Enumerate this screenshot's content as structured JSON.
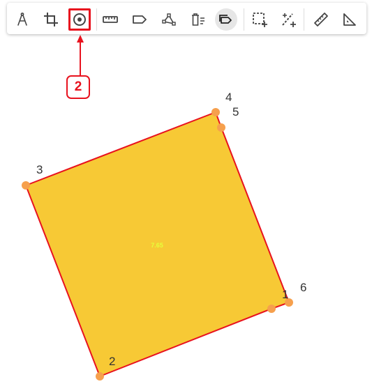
{
  "toolbar": {
    "tools": [
      {
        "id": "compass",
        "icon": "compass-icon",
        "title": ""
      },
      {
        "id": "crop",
        "icon": "crop-icon",
        "title": ""
      },
      {
        "id": "point",
        "icon": "target-point-icon",
        "title": "",
        "highlighted": true
      },
      {
        "id": "ruler",
        "icon": "ruler-icon",
        "title": ""
      },
      {
        "id": "label",
        "icon": "label-tag-icon",
        "title": ""
      },
      {
        "id": "polyline",
        "icon": "polyline-icon",
        "title": ""
      },
      {
        "id": "delete-list",
        "icon": "delete-list-icon",
        "title": ""
      },
      {
        "id": "polygon-tag",
        "icon": "polygon-tag-icon",
        "title": "",
        "active": true
      },
      {
        "id": "rect-add",
        "icon": "rect-select-add-icon",
        "title": ""
      },
      {
        "id": "slash-add",
        "icon": "slash-add-icon",
        "title": ""
      },
      {
        "id": "measure",
        "icon": "measure-ruler-icon",
        "title": ""
      },
      {
        "id": "angle",
        "icon": "set-square-icon",
        "title": ""
      }
    ]
  },
  "annotation": {
    "step_number": "2"
  },
  "polygon": {
    "area_label": "7.65",
    "fill_color": "#f7c935",
    "stroke_color": "#e8121e",
    "vertex_color": "#f6a04d",
    "vertex_labels": [
      "1",
      "2",
      "3",
      "4",
      "5",
      "6"
    ]
  },
  "colors": {
    "accent_red": "#e8121e",
    "icon_gray": "#444444",
    "active_bg": "#e6e6e6"
  }
}
